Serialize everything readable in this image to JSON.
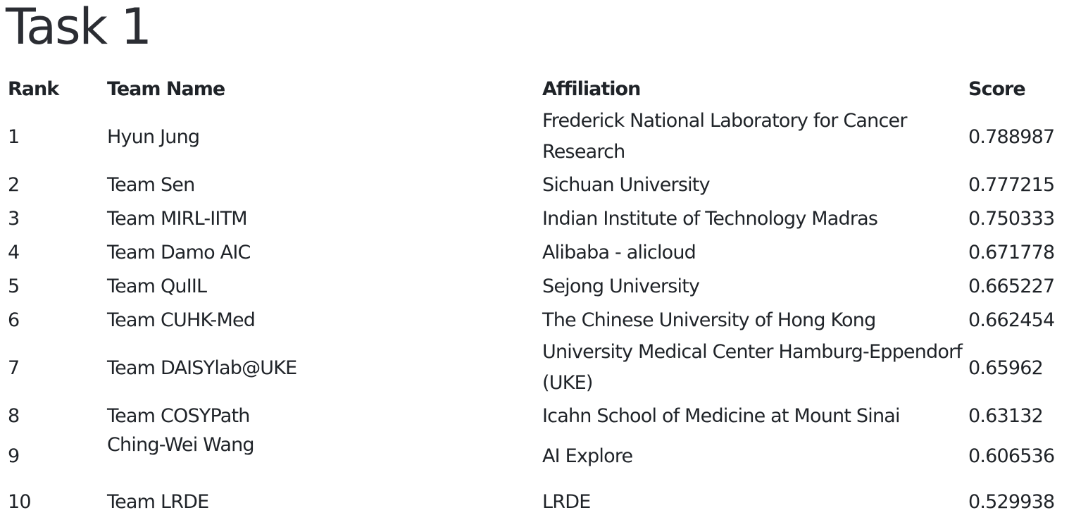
{
  "title": "Task 1",
  "table": {
    "headers": {
      "rank": "Rank",
      "team": "Team Name",
      "affiliation": "Affiliation",
      "score": "Score"
    },
    "rows": [
      {
        "rank": "1",
        "team": "Hyun Jung",
        "affiliation": "Frederick National Laboratory for Cancer Research",
        "score": "0.788987"
      },
      {
        "rank": "2",
        "team": "Team Sen",
        "affiliation": "Sichuan University",
        "score": "0.777215"
      },
      {
        "rank": "3",
        "team": "Team MIRL-IITM",
        "affiliation": "Indian Institute of Technology Madras",
        "score": "0.750333"
      },
      {
        "rank": "4",
        "team": "Team Damo AIC",
        "affiliation": "Alibaba - alicloud",
        "score": "0.671778"
      },
      {
        "rank": "5",
        "team": "Team QuIIL",
        "affiliation": "Sejong University",
        "score": "0.665227"
      },
      {
        "rank": "6",
        "team": "Team CUHK-Med",
        "affiliation": "The Chinese University of Hong Kong",
        "score": "0.662454"
      },
      {
        "rank": "7",
        "team": "Team DAISYlab@UKE",
        "affiliation": "University Medical Center Hamburg-Eppendorf (UKE)",
        "score": "0.65962"
      },
      {
        "rank": "8",
        "team": "Team COSYPath",
        "affiliation": "Icahn School of Medicine at Mount Sinai",
        "score": "0.63132"
      },
      {
        "rank": "9",
        "team": "Ching-Wei Wang",
        "affiliation": "AI Explore",
        "score": "0.606536"
      },
      {
        "rank": "10",
        "team": "Team LRDE",
        "affiliation": "LRDE",
        "score": "0.529938"
      }
    ]
  }
}
